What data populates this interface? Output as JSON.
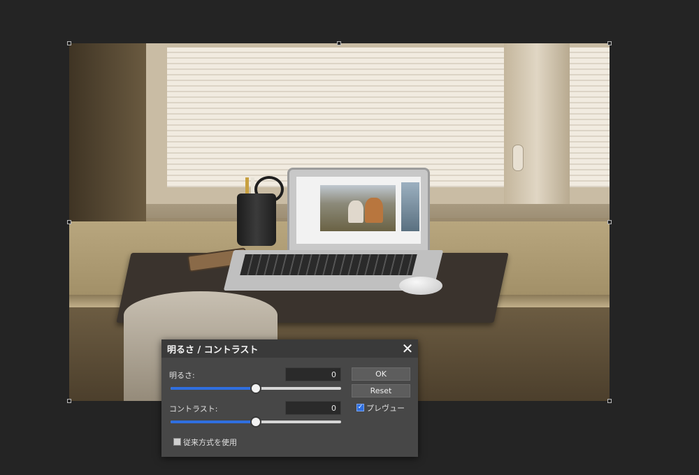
{
  "dialog": {
    "title": "明るさ / コントラスト",
    "close_icon": "close-icon",
    "brightness": {
      "label": "明るさ:",
      "value": "0",
      "slider_fraction": 0.5
    },
    "contrast": {
      "label": "コントラスト:",
      "value": "0",
      "slider_fraction": 0.5
    },
    "ok_label": "OK",
    "reset_label": "Reset",
    "preview": {
      "label": "プレヴュー",
      "checked": true
    },
    "legacy": {
      "label": "従来方式を使用",
      "checked": false
    }
  },
  "colors": {
    "background": "#242424",
    "dialog_bg": "#474747",
    "accent": "#2f6fe0"
  }
}
